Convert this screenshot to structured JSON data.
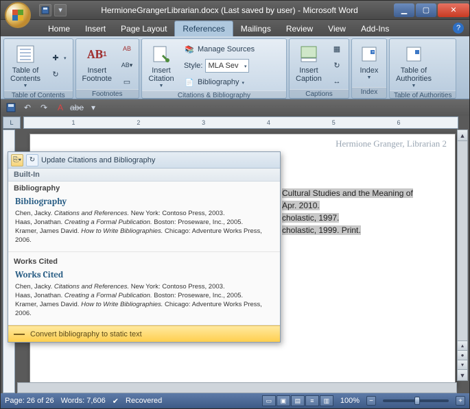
{
  "window": {
    "title": "HermioneGrangerLibrarian.docx (Last saved by user) - Microsoft Word"
  },
  "tabs": {
    "items": [
      "Home",
      "Insert",
      "Page Layout",
      "References",
      "Mailings",
      "Review",
      "View",
      "Add-Ins"
    ],
    "active": "References"
  },
  "ribbon": {
    "toc": {
      "label": "Table of\nContents",
      "group": "Table of Contents"
    },
    "footnote": {
      "label": "Insert\nFootnote",
      "ab": "AB",
      "group": "Footnotes"
    },
    "citation": {
      "label": "Insert\nCitation",
      "manage": "Manage Sources",
      "style_lbl": "Style:",
      "style_val": "MLA Sev",
      "biblio": "Bibliography",
      "group": "Citations & Bibliography"
    },
    "caption": {
      "label": "Insert\nCaption",
      "group": "Captions"
    },
    "index": {
      "label": "Index",
      "group": "Index"
    },
    "authorities": {
      "label": "Table of\nAuthorities",
      "group": "Table of Authorities"
    }
  },
  "page_header": "Hermione Granger, Librarian  2",
  "doc_lines": [
    "Cultural Studies and the Meaning of",
    " Apr. 2010.",
    "cholastic, 1997.",
    "cholastic, 1999. Print."
  ],
  "popup": {
    "update": "Update Citations and Bibliography",
    "builtin": "Built-In",
    "items": [
      {
        "title": "Bibliography",
        "heading": "Bibliography"
      },
      {
        "title": "Works Cited",
        "heading": "Works Cited"
      }
    ],
    "refs": [
      {
        "author": "Chen, Jacky.",
        "work": "Citations and References.",
        "rest": " New York: Contoso Press, 2003."
      },
      {
        "author": "Haas, Jonathan.",
        "work": "Creating a Formal Publication.",
        "rest": " Boston: Proseware, Inc., 2005."
      },
      {
        "author": "Kramer, James David.",
        "work": "How to Write Bibliographies.",
        "rest": " Chicago: Adventure Works Press, 2006."
      }
    ],
    "footer": "Convert bibliography to static text"
  },
  "status": {
    "page": "Page: 26 of 26",
    "words": "Words: 7,606",
    "recovered": "Recovered",
    "zoom": "100%"
  },
  "ruler_ticks": [
    "1",
    "2",
    "3",
    "4",
    "5",
    "6"
  ]
}
